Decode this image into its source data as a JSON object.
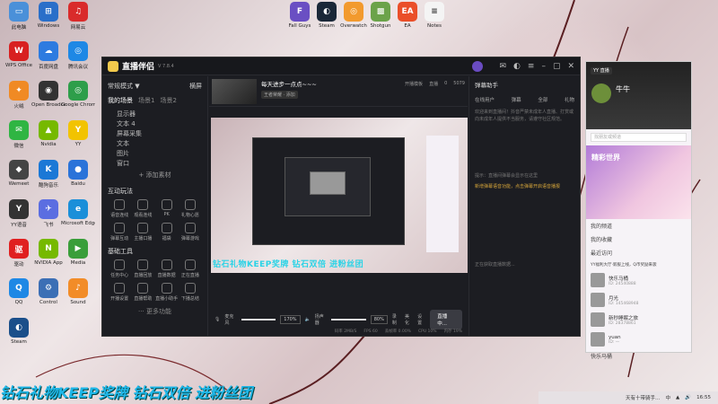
{
  "desktop": {
    "left_icons": [
      {
        "label": "此电脑",
        "color": "#4a90d9",
        "glyph": "▭"
      },
      {
        "label": "Windows",
        "color": "#2a6fc9",
        "glyph": "⊞"
      },
      {
        "label": "网易云",
        "color": "#d92b2b",
        "glyph": "♫"
      },
      {
        "label": "WPS Office",
        "color": "#d82020",
        "glyph": "W"
      },
      {
        "label": "百度网盘",
        "color": "#2d7be0",
        "glyph": "☁"
      },
      {
        "label": "腾讯会议",
        "color": "#1e88e5",
        "glyph": "◎"
      },
      {
        "label": "火绒",
        "color": "#f08a24",
        "glyph": "✦"
      },
      {
        "label": "Open Broadcast",
        "color": "#333",
        "glyph": "◉"
      },
      {
        "label": "Google Chrome",
        "color": "#2e9e4a",
        "glyph": "◎"
      },
      {
        "label": "微信",
        "color": "#2fb543",
        "glyph": "✉"
      },
      {
        "label": "Nvidia",
        "color": "#76b900",
        "glyph": "▲"
      },
      {
        "label": "YY",
        "color": "#f2c300",
        "glyph": "Y"
      },
      {
        "label": "Wemeet",
        "color": "#444",
        "glyph": "◆"
      },
      {
        "label": "酷狗音乐",
        "color": "#1b78d6",
        "glyph": "K"
      },
      {
        "label": "Baidu",
        "color": "#2a73d9",
        "glyph": "●"
      },
      {
        "label": "YY语音",
        "color": "#333",
        "glyph": "Y"
      },
      {
        "label": "飞书",
        "color": "#5b6ee1",
        "glyph": "✈"
      },
      {
        "label": "Microsoft Edge",
        "color": "#1a8fd9",
        "glyph": "e"
      },
      {
        "label": "驱动",
        "color": "#e02020",
        "glyph": "驱"
      },
      {
        "label": "NVIDIA App",
        "color": "#76b900",
        "glyph": "N"
      },
      {
        "label": "Media",
        "color": "#3a9e3a",
        "glyph": "▶"
      },
      {
        "label": "QQ",
        "color": "#1e88e5",
        "glyph": "Q"
      },
      {
        "label": "Control",
        "color": "#3c6fb5",
        "glyph": "⚙"
      },
      {
        "label": "Sound",
        "color": "#f28c28",
        "glyph": "♪"
      },
      {
        "label": "Steam",
        "color": "#1b4f8a",
        "glyph": "◐"
      }
    ],
    "top_icons": [
      {
        "label": "Fall Guys",
        "color": "#6a4fc3",
        "glyph": "F"
      },
      {
        "label": "Steam",
        "color": "#1b2838",
        "glyph": "◐"
      },
      {
        "label": "Overwatch",
        "color": "#f29a2e",
        "glyph": "◎"
      },
      {
        "label": "Shotgun",
        "color": "#6ba34a",
        "glyph": "▩"
      },
      {
        "label": "EA",
        "color": "#ea4f29",
        "glyph": "EA"
      },
      {
        "label": "Notes",
        "color": "#f4f4f4",
        "glyph": "≡"
      }
    ],
    "ticker_text": "钻石礼物KEEP奖牌  钻石双倍  进粉丝团"
  },
  "app": {
    "title": "直播伴侣",
    "version": "V 7.8.4",
    "mode_label": "常规模式 ▼",
    "mode_action": "横屏",
    "scene_label": "我的场景",
    "scene_tabs": [
      "场景1",
      "场景2"
    ],
    "sources": [
      "显示器",
      "文本 4",
      "屏幕采集",
      "文本",
      "图片",
      "窗口"
    ],
    "add_source": "+ 添加素材",
    "interact_title": "互动玩法",
    "interact_items": [
      "语音连线",
      "观看连线",
      "PK",
      "礼物心愿",
      "弹幕互动",
      "主播口播",
      "福袋",
      "弹幕游戏"
    ],
    "tools_title": "基础工具",
    "tool_items": [
      "任务中心",
      "直播回放",
      "直播数据",
      "正在直播",
      "开播设置",
      "直播帮助",
      "直播小助手",
      "下播总结"
    ],
    "more_label": "··· 更多功能",
    "live_title": "每天进步一点点~~~",
    "live_tag": "王者荣耀 · 添加",
    "live_stats": [
      "开播模板",
      "直播",
      "0",
      "5079"
    ],
    "preview_caption": "钻石礼物KEEP奖牌  钻石双倍  进粉丝团",
    "mic_label": "麦克风",
    "mic_pct": "170%",
    "speaker_label": "扬声器",
    "speaker_pct": "80%",
    "ctrl_buttons": [
      "录制",
      "美化",
      "设置"
    ],
    "go_live_label": "直播中...",
    "status_items": [
      "码率 2MB/S",
      "FPS 60",
      "丢帧率 0.00%",
      "CPU 10%",
      "内存 19%"
    ],
    "assist_title": "弹幕助手",
    "assist_tabs": [
      "在线用户",
      "弹幕",
      "全部",
      "礼物"
    ],
    "assist_msgs": [
      "欢迎来到直播间！抖音严禁未成年人直播、打赏或向未成年人提供不当服务，请遵守社区规范。",
      "提示：直播间弹幕会显示在这里",
      "正在获取直播数据..."
    ],
    "assist_highlight": "新增弹幕语音功能，点击弹幕开启语音播报"
  },
  "yy": {
    "header": "YY 直播",
    "user_name": "牛牛",
    "search_placeholder": "找朋友或频道",
    "banner_title": "精彩世界",
    "sections": [
      "我的频道",
      "我的收藏",
      "最近访问"
    ],
    "notice": "YY福利大厅·新服上线，Q币奖励来袭",
    "contacts": [
      {
        "name": "快乐马桶",
        "id": "ID: 24540888"
      },
      {
        "name": "月光",
        "id": "ID: 145468948"
      },
      {
        "name": "新秒睡眠之旅",
        "id": "ID: 28378861"
      },
      {
        "name": "yuan",
        "id": "ID: —"
      }
    ],
    "footer": "快乐马桶"
  },
  "taskbar": {
    "notice": "天有十带骑手…",
    "time": "16:55",
    "ime": "中"
  }
}
